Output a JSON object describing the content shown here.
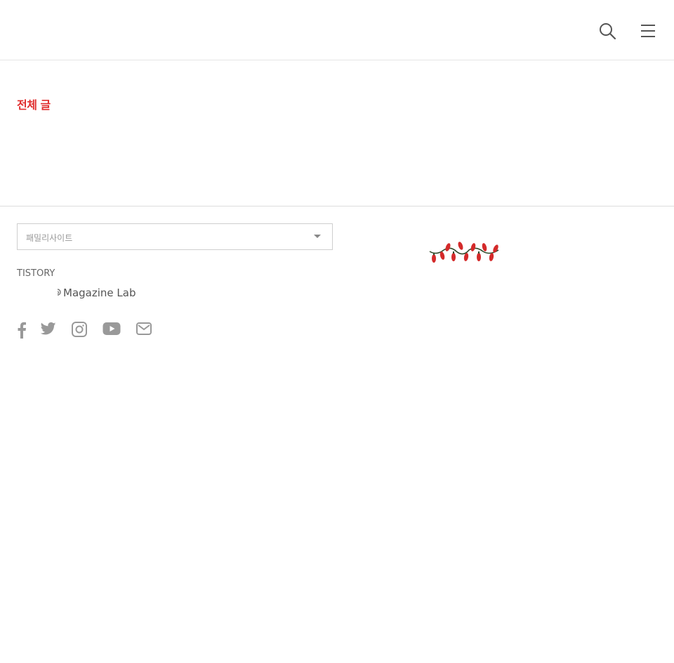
{
  "header": {
    "search_icon": "search-icon",
    "menu_icon": "hamburger-menu-icon"
  },
  "main": {
    "category_title": "전체 글"
  },
  "footer": {
    "family_site": {
      "selected": "패밀리사이트"
    },
    "tistory_label": "TISTORY",
    "brand_text": "Magazine Lab",
    "socials": [
      "facebook-icon",
      "twitter-icon",
      "instagram-icon",
      "youtube-icon",
      "mail-icon"
    ]
  },
  "colors": {
    "accent": "#e02d2d",
    "icon_gray": "#888888",
    "divider": "#dcdcdc"
  },
  "decoration": "christmas-lights-icon"
}
